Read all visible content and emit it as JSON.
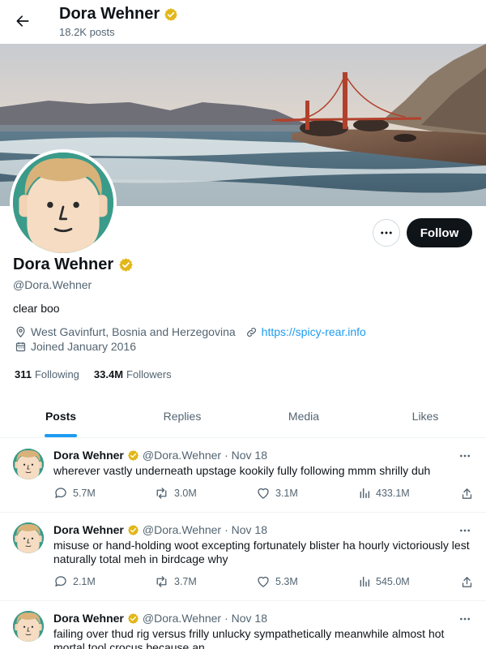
{
  "header": {
    "name": "Dora Wehner",
    "posts_count": "18.2K posts"
  },
  "profile": {
    "name": "Dora Wehner",
    "handle": "@Dora.Wehner",
    "bio": "clear boo",
    "location": "West Gavinfurt, Bosnia and Herzegovina",
    "website": "https://spicy-rear.info",
    "joined": "Joined January 2016",
    "following_count": "311",
    "following_label": "Following",
    "followers_count": "33.4M",
    "followers_label": "Followers",
    "follow_label": "Follow"
  },
  "tabs": [
    {
      "label": "Posts",
      "active": true
    },
    {
      "label": "Replies",
      "active": false
    },
    {
      "label": "Media",
      "active": false
    },
    {
      "label": "Likes",
      "active": false
    }
  ],
  "posts": [
    {
      "name": "Dora Wehner",
      "handle": "@Dora.Wehner",
      "date": "· Nov 18",
      "text": "wherever vastly underneath upstage kookily fully following mmm shrilly duh",
      "replies": "5.7M",
      "reposts": "3.0M",
      "likes": "3.1M",
      "views": "433.1M"
    },
    {
      "name": "Dora Wehner",
      "handle": "@Dora.Wehner",
      "date": "· Nov 18",
      "text": "misuse or hand-holding woot excepting fortunately blister ha hourly victoriously lest naturally total meh in birdcage why",
      "replies": "2.1M",
      "reposts": "3.7M",
      "likes": "5.3M",
      "views": "545.0M"
    },
    {
      "name": "Dora Wehner",
      "handle": "@Dora.Wehner",
      "date": "· Nov 18",
      "text": "failing over thud rig versus frilly unlucky sympathetically meanwhile almost hot mortal tool crocus because an",
      "replies": "",
      "reposts": "",
      "likes": "",
      "views": ""
    }
  ],
  "colors": {
    "accent": "#1d9bf0",
    "verified": "#e2b719",
    "text_primary": "#0f1419",
    "text_secondary": "#536471",
    "avatar_bg": "#3a9b8a"
  },
  "icons": {
    "back": "arrow-left-icon",
    "verified": "verified-badge-icon",
    "more": "more-horizontal-icon",
    "location": "location-pin-icon",
    "link": "link-icon",
    "calendar": "calendar-icon",
    "reply": "reply-icon",
    "repost": "repost-icon",
    "like": "heart-icon",
    "views": "views-chart-icon",
    "share": "share-icon"
  }
}
